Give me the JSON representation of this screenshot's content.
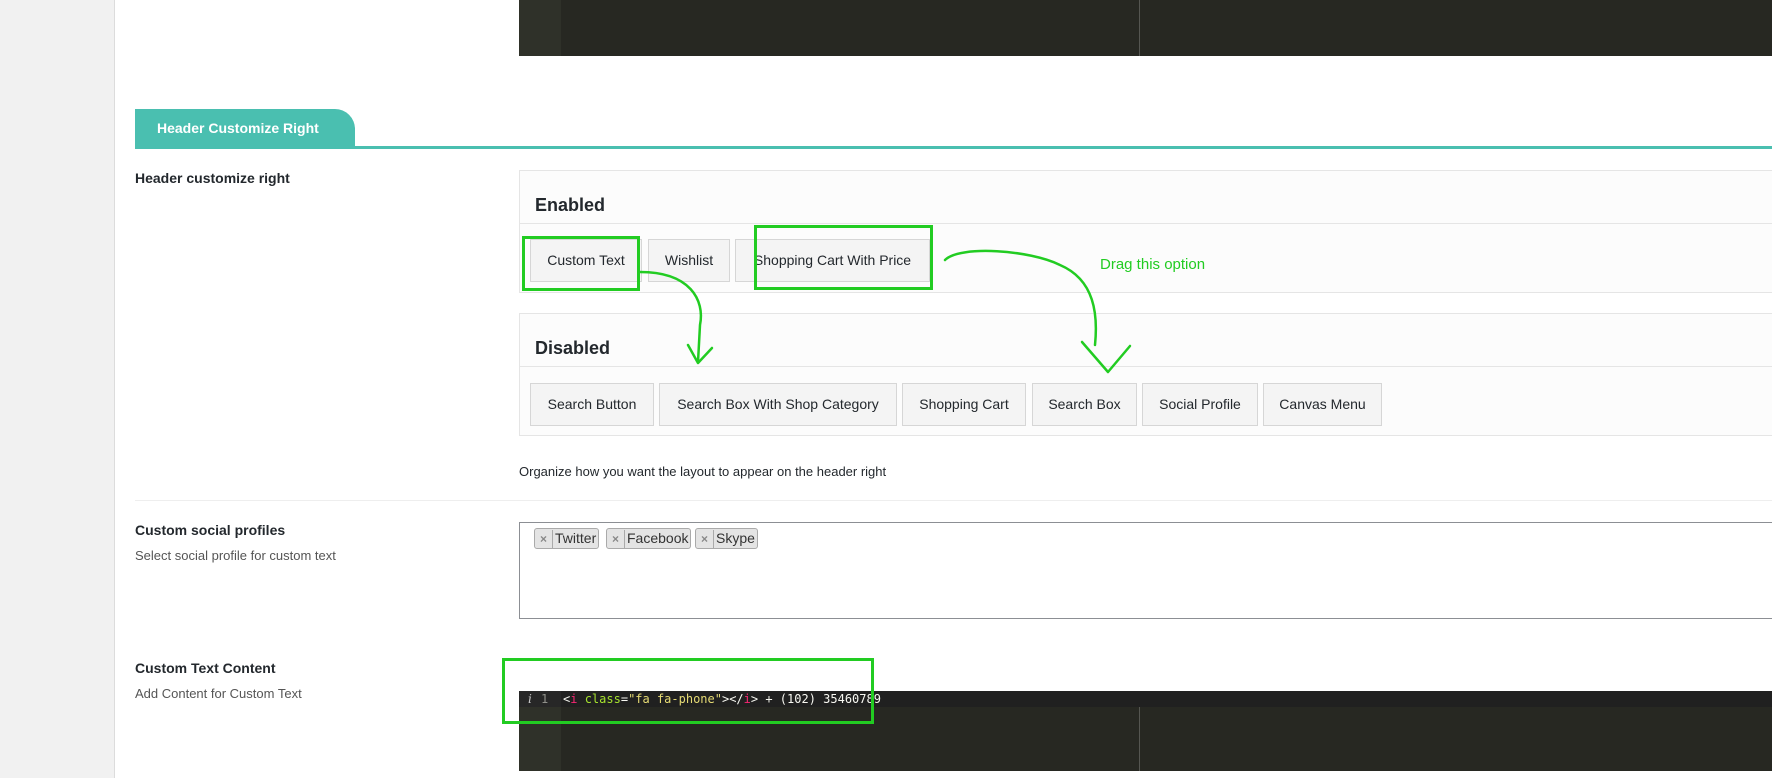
{
  "section": {
    "tab_title": "Header Customize Right"
  },
  "header_right": {
    "label": "Header customize right",
    "enabled_heading": "Enabled",
    "enabled_items": [
      "Custom Text",
      "Wishlist",
      "Shopping Cart With Price"
    ],
    "disabled_heading": "Disabled",
    "disabled_items": [
      "Search Button",
      "Search Box With Shop Category",
      "Shopping Cart",
      "Search Box",
      "Social Profile",
      "Canvas Menu"
    ],
    "helper_text": "Organize how you want the layout to appear on the header right"
  },
  "social_profiles": {
    "label": "Custom social profiles",
    "description": "Select social profile for custom text",
    "selected": [
      "Twitter",
      "Facebook",
      "Skype"
    ],
    "remove_glyph": "×"
  },
  "custom_text": {
    "label": "Custom Text Content",
    "description": "Add Content for Custom Text",
    "line_number": "1",
    "warning_glyph": "i",
    "code": {
      "open_bracket": "<",
      "tag": "i",
      "space": " ",
      "attr": "class",
      "equals": "=",
      "value": "\"fa fa-phone\"",
      "close_open": "></",
      "tag_close": "i",
      "rest": "> + (102) 35460789"
    }
  },
  "annotation": {
    "text": "Drag this option",
    "color": "#22cc22"
  },
  "colors": {
    "accent": "#4abfb0",
    "editor_bg": "#272822"
  }
}
